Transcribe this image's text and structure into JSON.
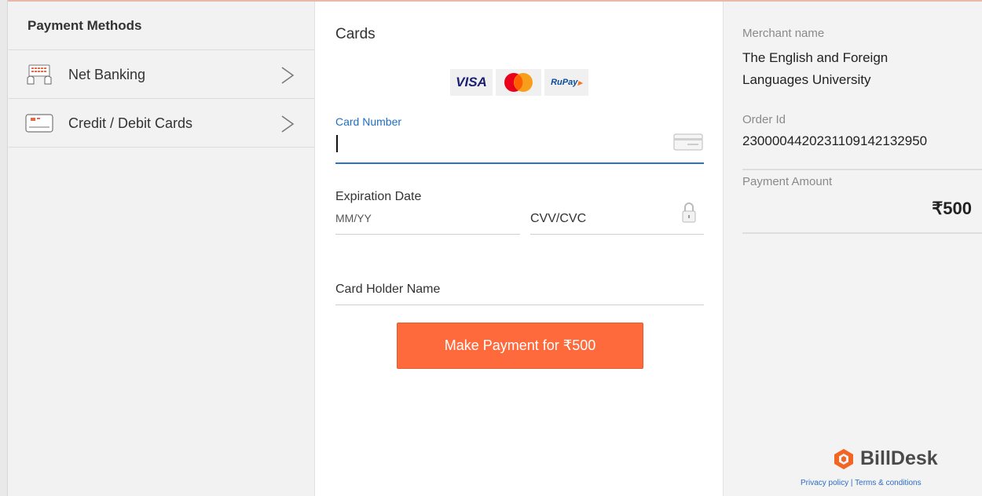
{
  "methods": {
    "title": "Payment Methods",
    "items": [
      {
        "label": "Net Banking",
        "icon": "keyboard-hands-icon"
      },
      {
        "label": "Credit / Debit Cards",
        "icon": "card-icon"
      }
    ]
  },
  "cards": {
    "title": "Cards",
    "brands": {
      "visa": "VISA",
      "rupay": "RuPay"
    },
    "card_number": {
      "label": "Card Number",
      "value": ""
    },
    "expiration": {
      "label": "Expiration Date",
      "placeholder": "MM/YY"
    },
    "cvv": {
      "placeholder": "CVV/CVC"
    },
    "holder": {
      "placeholder": "Card Holder Name"
    },
    "pay_button": "Make Payment for ₹500"
  },
  "summary": {
    "merchant_label": "Merchant name",
    "merchant_value": "The English and Foreign Languages University",
    "order_label": "Order Id",
    "order_value": "2300004420231109142132950",
    "amount_label": "Payment Amount",
    "amount_value": "₹500",
    "brand": "BillDesk",
    "privacy": "Privacy policy",
    "separator": "|",
    "terms": "Terms & conditions"
  },
  "colors": {
    "accent": "#ff6a3d",
    "focus": "#2b72c8",
    "link": "#2b6cc4"
  }
}
